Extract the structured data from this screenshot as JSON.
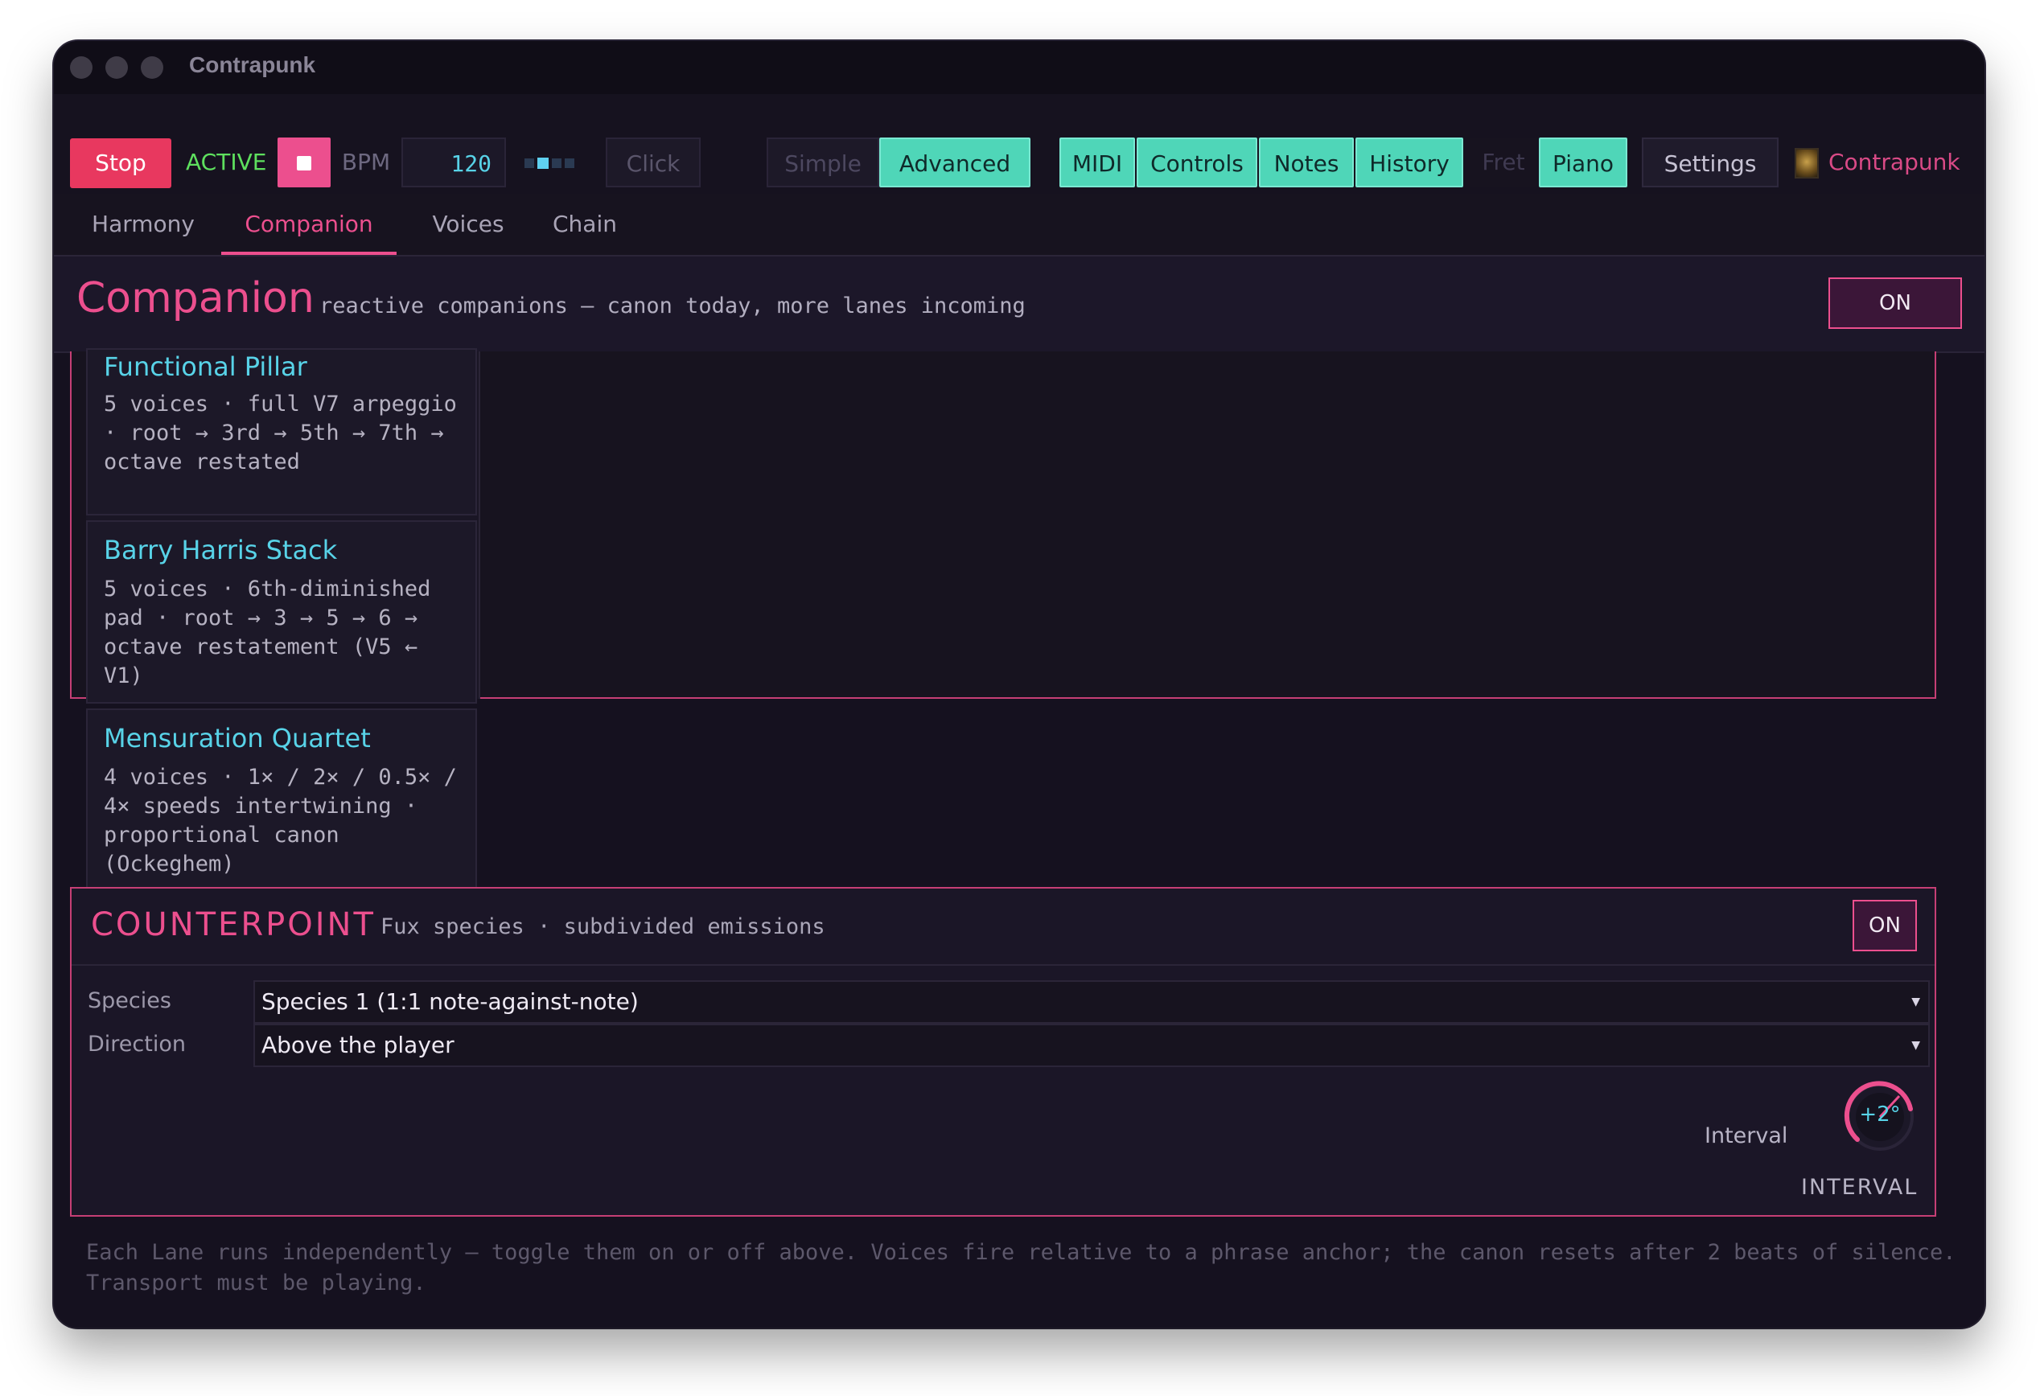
{
  "window": {
    "title": "Contrapunk"
  },
  "toolbar": {
    "stop": "Stop",
    "status": "ACTIVE",
    "bpm_label": "BPM",
    "bpm_value": "120",
    "click": "Click",
    "simple": "Simple",
    "advanced": "Advanced",
    "midi": "MIDI",
    "controls": "Controls",
    "notes": "Notes",
    "history": "History",
    "fret": "Fret",
    "piano": "Piano",
    "settings": "Settings",
    "brand": "Contrapunk"
  },
  "tabs": [
    "Harmony",
    "Companion",
    "Voices",
    "Chain"
  ],
  "companion": {
    "title": "Companion",
    "subtitle": "reactive companions — canon today, more lanes incoming",
    "toggle": "ON",
    "cards": [
      {
        "title": "Functional Pillar",
        "desc": "5 voices · full V7 arpeggio · root → 3rd → 5th → 7th → octave restated"
      },
      {
        "title": "Barry Harris Stack",
        "desc": "5 voices · 6th-diminished pad · root → 3 → 5 → 6 → octave restatement (V5 ← V1)"
      },
      {
        "title": "Mensuration Quartet",
        "desc": "4 voices · 1× / 2× / 0.5× / 4× speeds intertwining · proportional canon (Ockeghem)"
      }
    ]
  },
  "counterpoint": {
    "title": "COUNTERPOINT",
    "subtitle": "Fux species · subdivided emissions",
    "toggle": "ON",
    "species_label": "Species",
    "species_value": "Species 1 (1:1 note-against-note)",
    "direction_label": "Direction",
    "direction_value": "Above the player",
    "interval_label": "Interval",
    "interval_value": "+2°",
    "interval_caption": "INTERVAL"
  },
  "footer": "Each Lane runs independently — toggle them on or off above. Voices fire relative to a phrase anchor; the canon resets after 2 beats of silence. Transport must be playing.",
  "colors": {
    "accent": "#ec4f8e",
    "teal": "#4fd6b8",
    "cyan": "#58d3e8",
    "stop": "#e8385f",
    "active": "#5ee05e"
  },
  "icons": {
    "stop_square": "stop-square-icon",
    "level_meter": "level-meter-icon",
    "brand_logo": "app-logo-icon",
    "dropdown": "chevron-down-icon"
  }
}
